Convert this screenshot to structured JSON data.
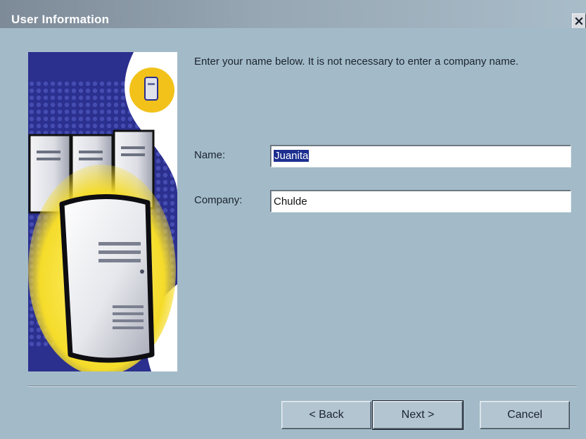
{
  "window": {
    "title": "User Information",
    "close_label": "×"
  },
  "intro_text": "Enter your name below.  It is not necessary to enter a company name.",
  "form": {
    "name_label": "Name:",
    "name_value": "Juanita",
    "company_label": "Company:",
    "company_value": "Chulde"
  },
  "buttons": {
    "back": "< Back",
    "next": "Next >",
    "cancel": "Cancel"
  },
  "colors": {
    "background": "#a3bbc8",
    "illustration_blue": "#2b2f8e",
    "accent_yellow": "#f2c21a",
    "selection": "#1c2f8f"
  },
  "icons": {
    "close": "close-icon",
    "illustration": "server-tower-illustration"
  }
}
